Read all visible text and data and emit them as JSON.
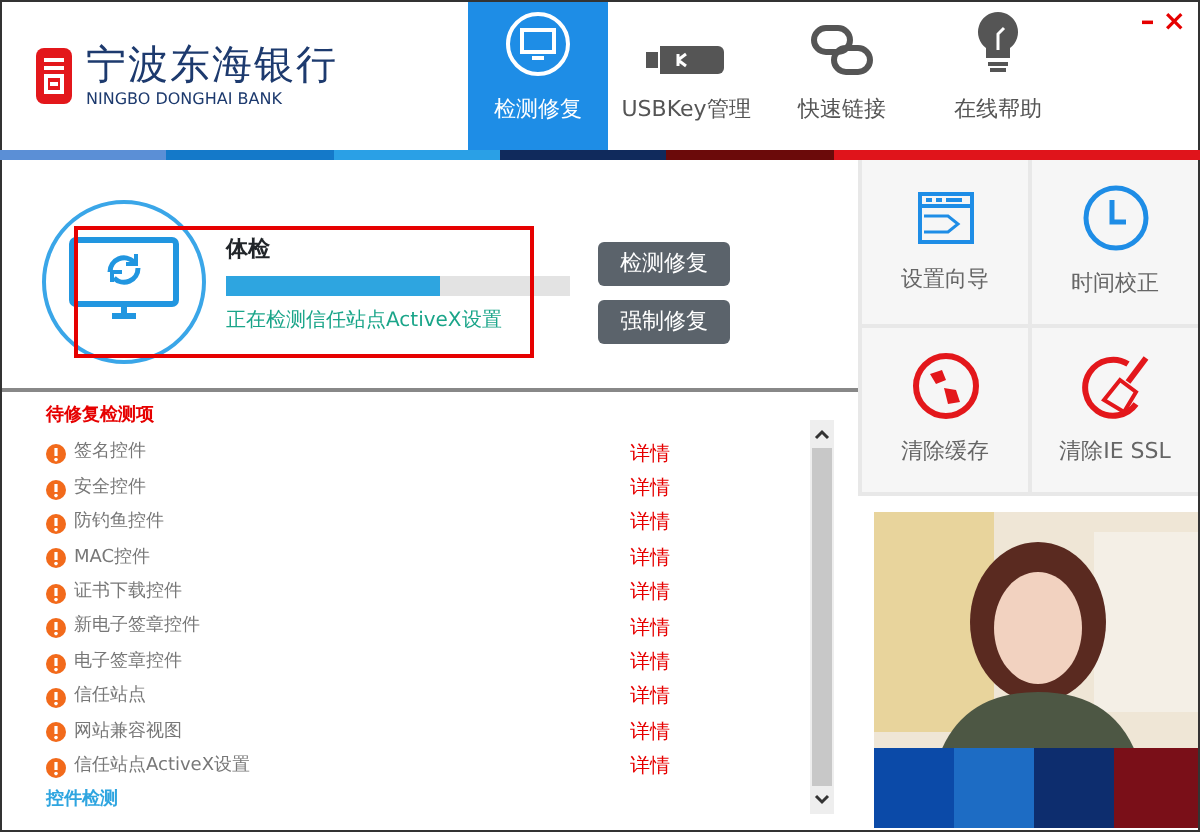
{
  "brand": {
    "name": "宁波东海银行",
    "english": "NINGBO DONGHAI BANK"
  },
  "tabs": [
    {
      "label": "检测修复",
      "kind": "repair",
      "selected": true
    },
    {
      "label": "USBKey管理",
      "kind": "usbkey",
      "selected": false
    },
    {
      "label": "快速链接",
      "kind": "link",
      "selected": false
    },
    {
      "label": "在线帮助",
      "kind": "help",
      "selected": false
    }
  ],
  "window_controls": [
    "–",
    "×"
  ],
  "scan": {
    "title": "体检",
    "level": 0.62,
    "status": "正在检测信任站点ActiveX设置"
  },
  "actions": [
    "检测修复",
    "强制修复"
  ],
  "checklist": {
    "heading": "待修复检测项",
    "items": [
      {
        "name": "签名控件",
        "detail": "详情"
      },
      {
        "name": "安全控件",
        "detail": "详情"
      },
      {
        "name": "防钓鱼控件",
        "detail": "详情"
      },
      {
        "name": "MAC控件",
        "detail": "详情"
      },
      {
        "name": "证书下载控件",
        "detail": "详情"
      },
      {
        "name": "新电子签章控件",
        "detail": "详情"
      },
      {
        "name": "电子签章控件",
        "detail": "详情"
      },
      {
        "name": "信任站点",
        "detail": "详情"
      },
      {
        "name": "网站兼容视图",
        "detail": "详情"
      },
      {
        "name": "信任站点ActiveX设置",
        "detail": "详情"
      }
    ],
    "footer": "控件检测"
  },
  "tools": [
    {
      "label": "设置向导",
      "kind": "wizard"
    },
    {
      "label": "时间校正",
      "kind": "clock"
    },
    {
      "label": "清除缓存",
      "kind": "cache"
    },
    {
      "label": "清除IE SSL",
      "kind": "broom"
    }
  ]
}
